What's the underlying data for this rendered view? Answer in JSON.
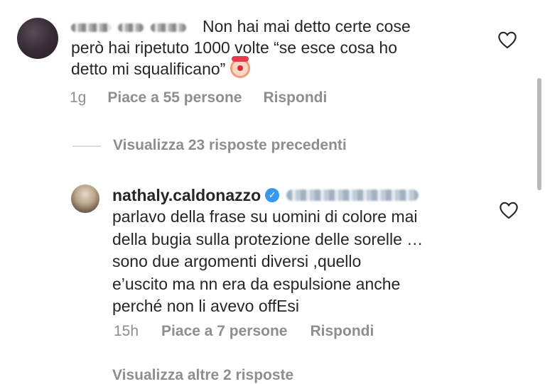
{
  "comment1": {
    "text_line1": "Non hai mai detto certe cose",
    "text_line2": "però hai ripetuto 1000 volte “se esce cosa ho",
    "text_line3": "detto mi squalificano”",
    "time": "1g",
    "likes": "Piace a 55 persone",
    "reply": "Rispondi",
    "icons": {
      "like": "heart-outline-icon",
      "emoji": "clown-face-icon"
    }
  },
  "view_replies": "Visualizza 23 risposte precedenti",
  "comment2": {
    "username": "nathaly.caldonazzo",
    "text": "parlavo della frase su uomini di colore mai\ndella bugia sulla protezione delle sorelle …\nsono due argomenti diversi ,quello\ne’uscito ma nn era da espulsione anche\nperché non li avevo offEsi",
    "time": "15h",
    "likes": "Piace a 7 persone",
    "reply": "Rispondi",
    "icons": {
      "verified": "verified-badge-icon",
      "like": "heart-outline-icon"
    }
  },
  "next_link_cutoff": "Visualizza altre 2 risposte",
  "colors": {
    "text": "#262626",
    "meta": "#8e8e8e",
    "verified": "#3897f0"
  }
}
